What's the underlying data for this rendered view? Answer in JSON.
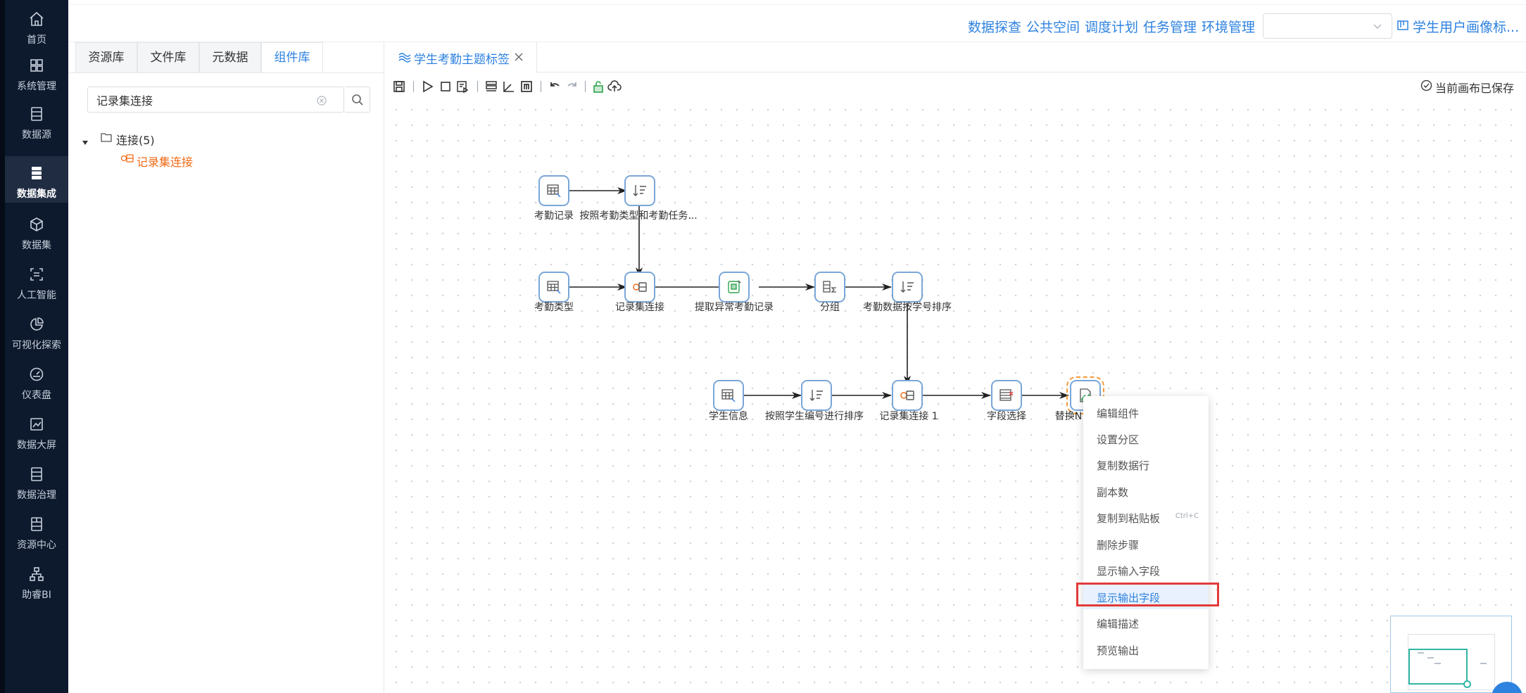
{
  "sidebar": {
    "items": [
      {
        "label": "首页",
        "icon": "home-icon"
      },
      {
        "label": "系统管理",
        "icon": "grid-icon"
      },
      {
        "label": "数据源",
        "icon": "database-icon"
      },
      {
        "label": "数据集成",
        "icon": "data-integration-icon",
        "active": true
      },
      {
        "label": "数据集",
        "icon": "cube-icon"
      },
      {
        "label": "人工智能",
        "icon": "ai-icon"
      },
      {
        "label": "可视化探索",
        "icon": "pie-chart-icon"
      },
      {
        "label": "仪表盘",
        "icon": "gauge-icon"
      },
      {
        "label": "数据大屏",
        "icon": "line-chart-icon"
      },
      {
        "label": "数据治理",
        "icon": "governance-icon"
      },
      {
        "label": "资源中心",
        "icon": "resource-icon"
      },
      {
        "label": "助睿BI",
        "icon": "org-chart-icon"
      }
    ]
  },
  "topbar": {
    "links": [
      "数据探查",
      "公共空间",
      "调度计划",
      "任务管理",
      "环境管理"
    ],
    "select_value": "",
    "project_name": "学生用户画像标..."
  },
  "panel": {
    "tabs": [
      "资源库",
      "文件库",
      "元数据",
      "组件库"
    ],
    "active_tab": "组件库",
    "search_value": "记录集连接",
    "tree_root": "连接(5)",
    "tree_leaf": "记录集连接"
  },
  "editor": {
    "tab_title": "学生考勤主题标签",
    "save_status": "当前画布已保存",
    "nodes": [
      {
        "label": "考勤记录"
      },
      {
        "label": "按照考勤类型和考勤任务..."
      },
      {
        "label": "考勤类型"
      },
      {
        "label": "记录集连接"
      },
      {
        "label": "提取异常考勤记录"
      },
      {
        "label": "分组"
      },
      {
        "label": "考勤数据按学号排序"
      },
      {
        "label": "学生信息"
      },
      {
        "label": "按照学生编号进行排序"
      },
      {
        "label": "记录集连接 1"
      },
      {
        "label": "字段选择"
      },
      {
        "label": "替换N"
      }
    ]
  },
  "context_menu": {
    "items": [
      "编辑组件",
      "设置分区",
      "复制数据行",
      "副本数",
      "复制到粘贴板",
      "删除步骤",
      "显示输入字段",
      "显示输出字段",
      "编辑描述",
      "预览输出"
    ],
    "copy_shortcut": "Ctrl+C",
    "highlighted": "显示输出字段"
  },
  "colors": {
    "sidebar_bg": "#0d1a2e",
    "accent": "#2e82e0",
    "leaf_orange": "#f06a15",
    "highlight_red": "#e23b3b",
    "node_border": "#7aa6d8"
  }
}
